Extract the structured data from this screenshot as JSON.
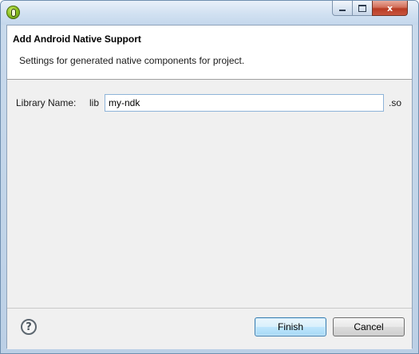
{
  "window": {
    "minimize_label": "",
    "close_label": "x"
  },
  "header": {
    "title": "Add Android Native Support",
    "description": "Settings for generated native components for project."
  },
  "form": {
    "library_label": "Library Name:",
    "prefix": "lib",
    "library_value": "my-ndk",
    "suffix": ".so"
  },
  "footer": {
    "help_glyph": "?",
    "finish_label": "Finish",
    "cancel_label": "Cancel"
  },
  "colors": {
    "title_bar": "#c4d7ec",
    "close_button": "#c9563f",
    "default_button_border": "#3c7fb1",
    "input_border": "#8eb4d9"
  }
}
